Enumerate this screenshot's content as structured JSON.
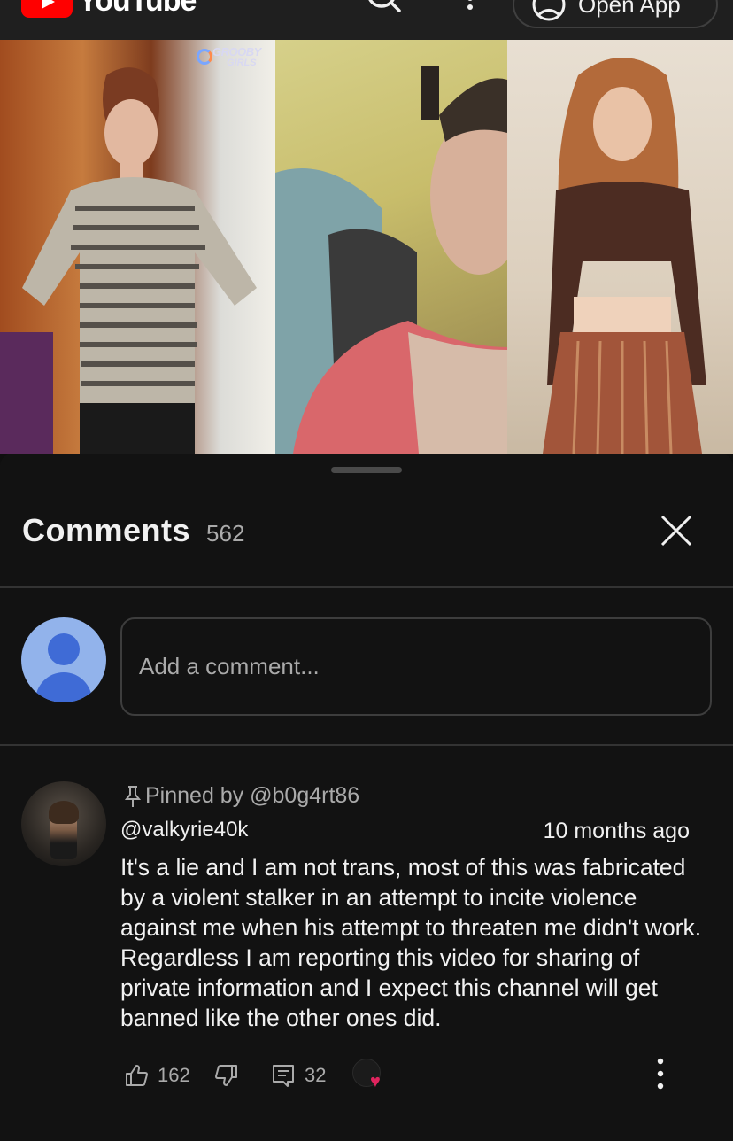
{
  "topbar": {
    "logo_text": "YouTube",
    "open_app_label": "Open App"
  },
  "video": {
    "watermark_line1": "GROOBY",
    "watermark_line2": "GIRLS"
  },
  "comments": {
    "title": "Comments",
    "count": "562",
    "add_placeholder": "Add a comment...",
    "items": [
      {
        "pinned_label": "Pinned by @b0g4rt86",
        "author": "@valkyrie40k",
        "time": "10 months ago",
        "text": "It's a lie and I am not trans, most of this was fabricated by a violent stalker in an attempt to incite violence against me when his attempt to threaten me didn't work.   Regardless I am reporting this video for sharing of private information and I expect this channel will get banned like the other ones did.",
        "likes": "162",
        "replies": "32",
        "creator_heart": true
      }
    ]
  },
  "colors": {
    "background": "#0f0f0f",
    "sheet": "#121212",
    "text_primary": "#f1f1f1",
    "text_secondary": "#aaaaaa",
    "brand_red": "#ff0000",
    "avatar_blue": "#92b3eb",
    "heart": "#e0245e"
  },
  "icons": [
    "youtube-logo-icon",
    "search-icon",
    "more-vert-icon",
    "account-icon",
    "close-icon",
    "pin-icon",
    "thumb-up-icon",
    "thumb-down-icon",
    "reply-icon",
    "creator-heart-icon",
    "more-vert-icon"
  ]
}
